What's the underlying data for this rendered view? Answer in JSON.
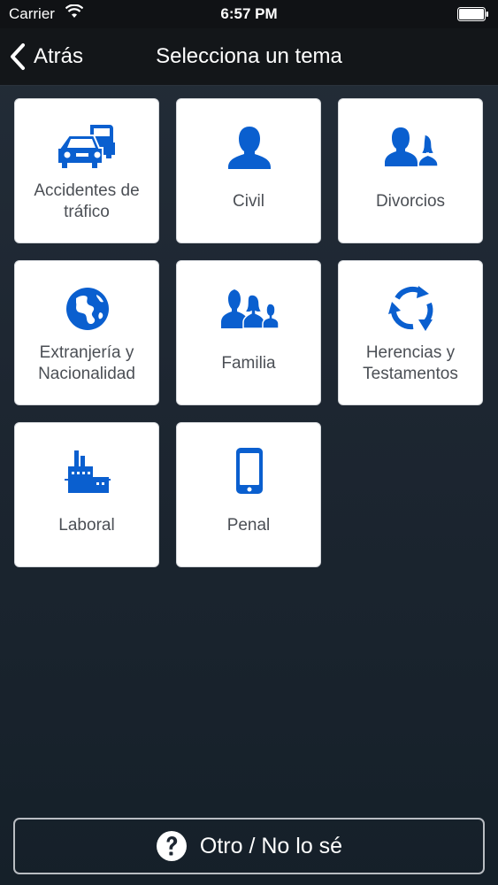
{
  "status_bar": {
    "carrier": "Carrier",
    "time": "6:57 PM"
  },
  "nav": {
    "back_label": "Atrás",
    "title": "Selecciona un tema"
  },
  "topics": [
    {
      "label_line1": "Accidentes de",
      "label_line2": "tráfico",
      "icon": "cars-icon"
    },
    {
      "label_line1": "Civil",
      "label_line2": "",
      "icon": "person-icon"
    },
    {
      "label_line1": "Divorcios",
      "label_line2": "",
      "icon": "couple-icon"
    },
    {
      "label_line1": "Extranjería y",
      "label_line2": "Nacionalidad",
      "icon": "globe-icon"
    },
    {
      "label_line1": "Familia",
      "label_line2": "",
      "icon": "family-icon"
    },
    {
      "label_line1": "Herencias y",
      "label_line2": "Testamentos",
      "icon": "recycle-arrows-icon"
    },
    {
      "label_line1": "Laboral",
      "label_line2": "",
      "icon": "factory-icon"
    },
    {
      "label_line1": "Penal",
      "label_line2": "",
      "icon": "mobile-phone-icon"
    }
  ],
  "other_button": {
    "label": "Otro / No lo sé",
    "icon": "question-circle-icon"
  },
  "colors": {
    "accent": "#0a5fcf",
    "tile_background": "#ffffff",
    "nav_background": "#131619",
    "page_background": "#1d2631"
  }
}
